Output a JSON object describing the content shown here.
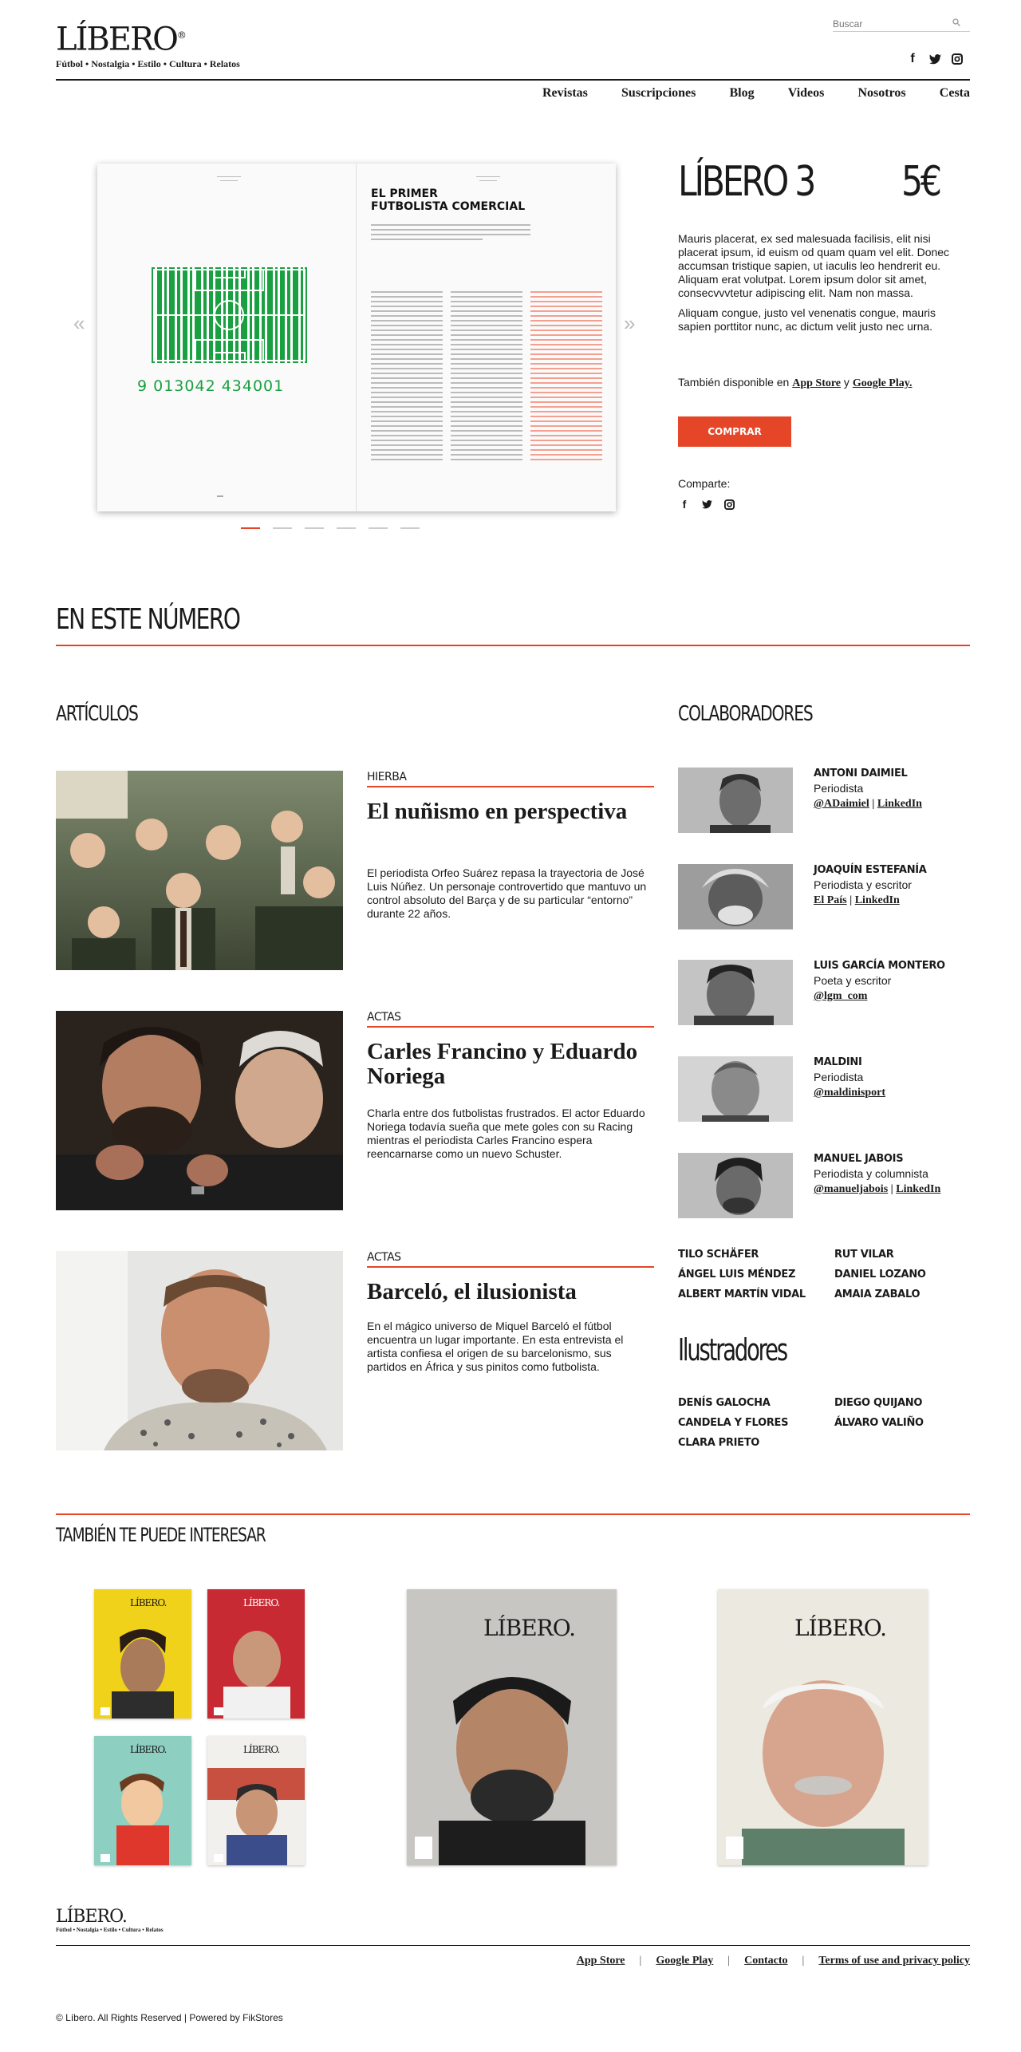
{
  "brand": {
    "name": "LÍBERO",
    "tagline": "Fútbol • Nostalgia • Estilo • Cultura • Relatos",
    "accent": "#e64628"
  },
  "search": {
    "placeholder": "Buscar"
  },
  "social": [
    "facebook-icon",
    "twitter-icon",
    "instagram-icon"
  ],
  "nav": [
    "Revistas",
    "Suscripciones",
    "Blog",
    "Videos",
    "Nosotros",
    "Cesta"
  ],
  "spread": {
    "page_title_1": "EL PRIMER",
    "page_title_2": "FUTBOLISTA COMERCIAL",
    "barcode_number": "9 013042 434001"
  },
  "product": {
    "title": "LÍBERO 3",
    "price": "5€",
    "desc1": "Mauris placerat, ex sed malesuada facilisis, elit nisi placerat ipsum, id euism od quam quam vel elit. Donec accumsan tristique sapien, ut iaculis leo hendrerit eu. Aliquam erat volutpat. Lorem ipsum dolor sit amet, consecvvvtetur adipiscing elit. Nam non massa.",
    "desc2": "Aliquam congue, justo vel venenatis congue, mauris sapien porttitor nunc, ac dictum velit justo nec urna.",
    "avail_prefix": "También disponible en",
    "app_store": "App Store",
    "avail_joiner": "y",
    "google_play": "Google Play.",
    "buy": "COMPRAR",
    "share": "Comparte:"
  },
  "section": {
    "title": "EN ESTE NÚMERO",
    "articles": "ARTÍCULOS",
    "collaborators": "COLABORADORES"
  },
  "articles": [
    {
      "category": "HIERBA",
      "title": "El nuñismo en perspectiva",
      "text": "El periodista Orfeo Suárez repasa la trayectoria de José Luis Núñez. Un personaje controvertido que mantuvo un control absoluto del Barça y de su particular “entorno” durante 22 años."
    },
    {
      "category": "ACTAS",
      "title": "Carles Francino y Eduardo Noriega",
      "text": "Charla entre dos futbolistas frustrados. El actor Eduardo Noriega todavía sueña que mete goles con su Racing mientras el periodista Carles Francino espera reencarnarse como un nuevo Schuster."
    },
    {
      "category": "ACTAS",
      "title": "Barceló, el ilusionista",
      "text": "En el mágico universo de Miquel Barceló el fútbol encuentra un lugar importante. En esta entrevista el artista confiesa el origen de su barcelonismo, sus partidos en África y sus pinitos como futbolista."
    }
  ],
  "collaborators": [
    {
      "name": "ANTONI DAIMIEL",
      "role": "Periodista",
      "link1": "@ADaimiel",
      "link2": "LinkedIn"
    },
    {
      "name": "JOAQUÍN ESTEFANÍA",
      "role": "Periodista y escritor",
      "link1": "El País",
      "link2": "LinkedIn"
    },
    {
      "name": "LUIS GARCÍA MONTERO",
      "role": "Poeta y escritor",
      "link1": "@lgm_com"
    },
    {
      "name": "MALDINI",
      "role": "Periodista",
      "link1": "@maldinisport"
    },
    {
      "name": "MANUEL JABOIS",
      "role": "Periodista y columnista",
      "link1": "@manueljabois",
      "link2": "LinkedIn"
    }
  ],
  "more_collaborators": [
    "TILO SCHÄFER",
    "RUT VILAR",
    "ÁNGEL LUIS MÉNDEZ",
    "DANIEL LOZANO",
    "ALBERT MARTÍN VIDAL",
    "AMAIA ZABALO"
  ],
  "illustrators_title": "Ilustradores",
  "illustrators": [
    "DENÍS GALOCHA",
    "DIEGO QUIJANO",
    "CANDELA Y FLORES",
    "ÁLVARO VALIÑO",
    "CLARA PRIETO"
  ],
  "related_title": "TAMBIÉN TE PUEDE INTERESAR",
  "footer": {
    "logo": "LÍBERO.",
    "tagline": "Fútbol • Nostalgia • Estilo • Cultura • Relatos",
    "links": [
      "App Store",
      "Google Play",
      "Contacto",
      "Terms of use and privacy policy"
    ],
    "sep": "|",
    "copyright": "© Líbero. All Rights Reserved | Powered by FikStores"
  }
}
